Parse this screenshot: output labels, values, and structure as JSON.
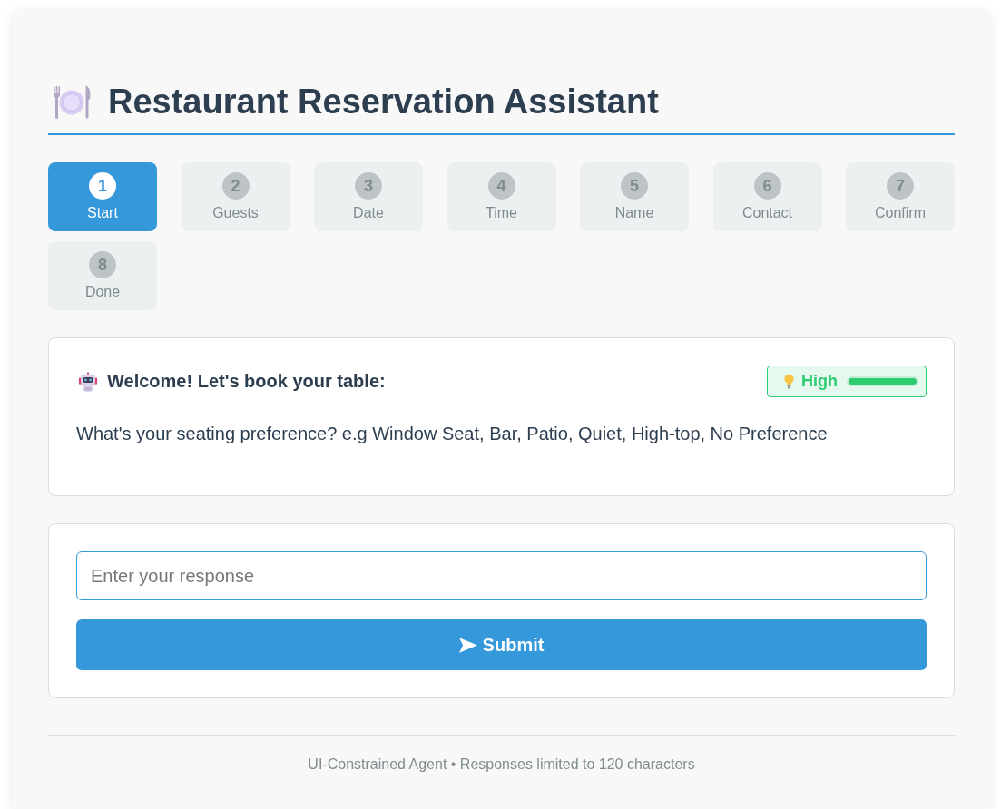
{
  "app": {
    "title": "Restaurant Reservation Assistant"
  },
  "steps": [
    {
      "number": "1",
      "label": "Start",
      "selected": true
    },
    {
      "number": "2",
      "label": "Guests",
      "selected": false
    },
    {
      "number": "3",
      "label": "Date",
      "selected": false
    },
    {
      "number": "4",
      "label": "Time",
      "selected": false
    },
    {
      "number": "5",
      "label": "Name",
      "selected": false
    },
    {
      "number": "6",
      "label": "Contact",
      "selected": false
    },
    {
      "number": "7",
      "label": "Confirm",
      "selected": false
    },
    {
      "number": "8",
      "label": "Done",
      "selected": false
    }
  ],
  "message": {
    "heading": "Welcome! Let's book your table:",
    "confidence": {
      "label": "High",
      "level": 1
    },
    "question": "What's your seating preference? e.g Window Seat, Bar, Patio, Quiet, High-top, No Preference"
  },
  "response_form": {
    "placeholder": "Enter your response",
    "submit_label": "Submit"
  },
  "footer": "UI-Constrained Agent • Responses limited to 120 characters"
}
